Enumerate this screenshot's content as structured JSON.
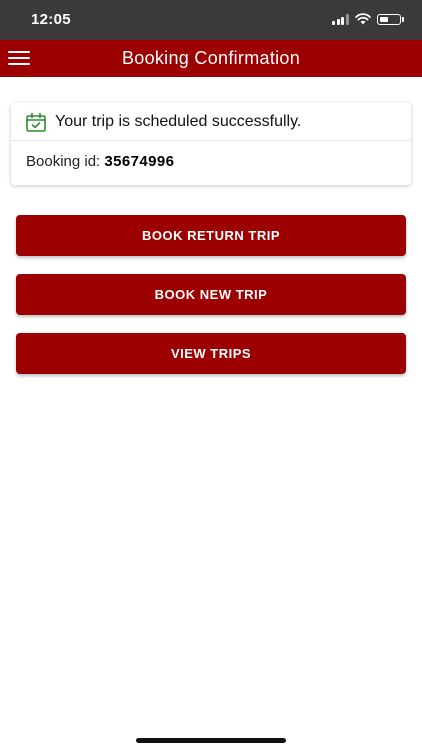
{
  "status_bar": {
    "time": "12:05"
  },
  "header": {
    "title": "Booking Confirmation",
    "menu_icon": "hamburger-menu-icon"
  },
  "confirmation": {
    "icon": "calendar-check-icon",
    "message": "Your trip is scheduled successfully.",
    "booking_label": "Booking id:",
    "booking_id": "35674996"
  },
  "actions": {
    "book_return_trip": "BOOK RETURN TRIP",
    "book_new_trip": "BOOK NEW TRIP",
    "view_trips": "VIEW TRIPS"
  },
  "colors": {
    "brand": "#9d0000",
    "status_bar": "#3a3a3c",
    "success_icon": "#2e8b2e"
  }
}
